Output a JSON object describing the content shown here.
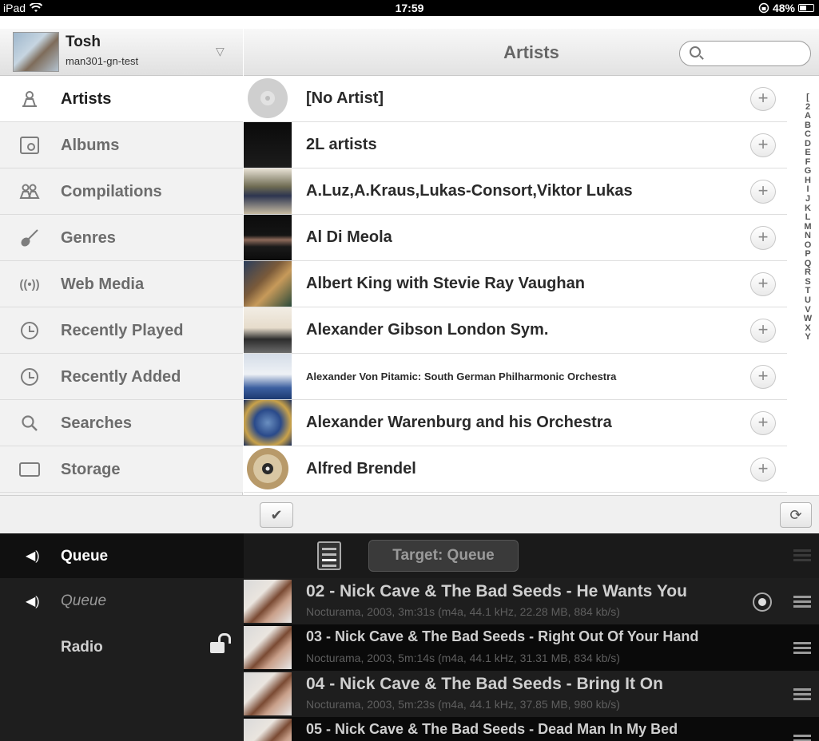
{
  "status_bar": {
    "device": "iPad",
    "time": "17:59",
    "battery": "48%",
    "battery_level": 0.48
  },
  "profile": {
    "name": "Tosh",
    "server": "man301-gn-test"
  },
  "header": {
    "title": "Artists",
    "search_placeholder": ""
  },
  "sidebar": {
    "items": [
      {
        "label": "Artists",
        "icon": "person-icon",
        "active": true
      },
      {
        "label": "Albums",
        "icon": "album-icon"
      },
      {
        "label": "Compilations",
        "icon": "people-icon"
      },
      {
        "label": "Genres",
        "icon": "guitar-icon"
      },
      {
        "label": "Web Media",
        "icon": "antenna-icon"
      },
      {
        "label": "Recently Played",
        "icon": "recent-played-icon"
      },
      {
        "label": "Recently Added",
        "icon": "recent-added-icon"
      },
      {
        "label": "Searches",
        "icon": "search-icon"
      },
      {
        "label": "Storage",
        "icon": "storage-icon"
      }
    ]
  },
  "artists": [
    {
      "name": "[No Artist]"
    },
    {
      "name": "2L artists"
    },
    {
      "name": "A.Luz,A.Kraus,Lukas-Consort,Viktor Lukas"
    },
    {
      "name": "Al Di Meola"
    },
    {
      "name": "Albert King with Stevie Ray Vaughan"
    },
    {
      "name": "Alexander Gibson London Sym."
    },
    {
      "name": "Alexander Von Pitamic: South German Philharmonic Orchestra"
    },
    {
      "name": "Alexander Warenburg and his Orchestra"
    },
    {
      "name": "Alfred Brendel"
    }
  ],
  "alpha_index": [
    "[",
    "2",
    "A",
    "B",
    "C",
    "D",
    "E",
    "F",
    "G",
    "H",
    "I",
    "J",
    "K",
    "L",
    "M",
    "N",
    "O",
    "P",
    "Q",
    "R",
    "S",
    "T",
    "U",
    "V",
    "W",
    "X",
    "Y"
  ],
  "queue_bar": {
    "label": "Queue",
    "target_label": "Target: Queue"
  },
  "playback_sidebar": [
    {
      "label": "Queue",
      "style": "italic"
    },
    {
      "label": "Radio",
      "style": "bold"
    }
  ],
  "tracks": [
    {
      "title": "02 - Nick Cave & The Bad Seeds - He Wants You",
      "meta": "Nocturama, 2003,  3m:31s (m4a, 44.1 kHz, 22.28 MB, 884 kb/s)"
    },
    {
      "title": "03 - Nick Cave & The Bad Seeds - Right Out Of Your Hand",
      "meta": "Nocturama, 2003,  5m:14s (m4a, 44.1 kHz, 31.31 MB, 834 kb/s)"
    },
    {
      "title": "04 - Nick Cave & The Bad Seeds - Bring It On",
      "meta": "Nocturama, 2003,  5m:23s (m4a, 44.1 kHz, 37.85 MB, 980 kb/s)"
    },
    {
      "title": "05 - Nick Cave & The Bad Seeds - Dead Man In My Bed",
      "meta": ""
    }
  ]
}
